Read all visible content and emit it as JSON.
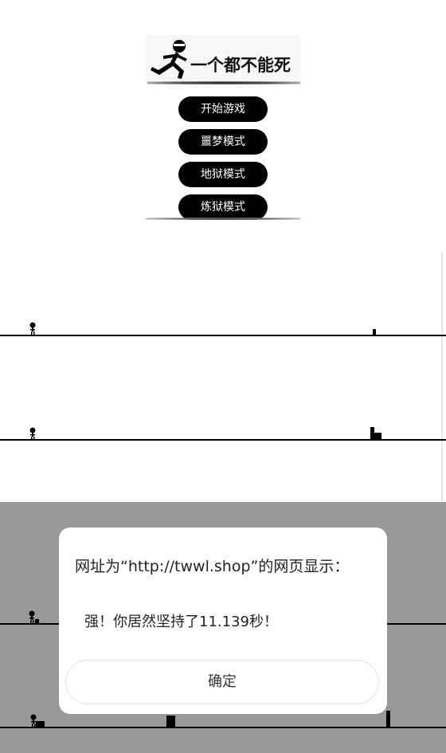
{
  "app": {
    "logo_title": "一个都不能死"
  },
  "menu": {
    "items": [
      {
        "label": "开始游戏"
      },
      {
        "label": "噩梦模式"
      },
      {
        "label": "地狱模式"
      },
      {
        "label": "炼狱模式"
      }
    ]
  },
  "dialog": {
    "title": "网址为“http://twwl.shop”的网页显示：",
    "message": "强！你居然坚持了11.139秒！",
    "ok_label": "确定"
  },
  "colors": {
    "overlay": "#999999",
    "button_bg": "#000000",
    "button_text": "#ffffff"
  },
  "icons": {
    "logo": "running-man-icon",
    "player": "stick-runner-icon"
  }
}
